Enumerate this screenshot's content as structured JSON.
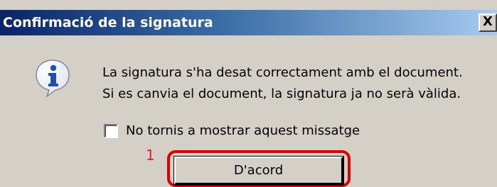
{
  "window": {
    "title": "Confirmació de la signatura",
    "close_label": "X"
  },
  "dialog": {
    "icon": "info-icon",
    "message_lines": [
      "La signatura s'ha desat correctament amb el document.",
      "Si es canvia el document, la signatura ja no serà vàlida."
    ],
    "checkbox": {
      "label": "No tornis a mostrar aquest missatge",
      "checked": false
    },
    "ok_button_label": "D'acord"
  },
  "annotation": {
    "number": "1",
    "color": "#e00000"
  },
  "colors": {
    "title_bar_start": "#0a246a",
    "title_bar_end": "#a6caf0",
    "dialog_background": "#d4d0c8"
  }
}
